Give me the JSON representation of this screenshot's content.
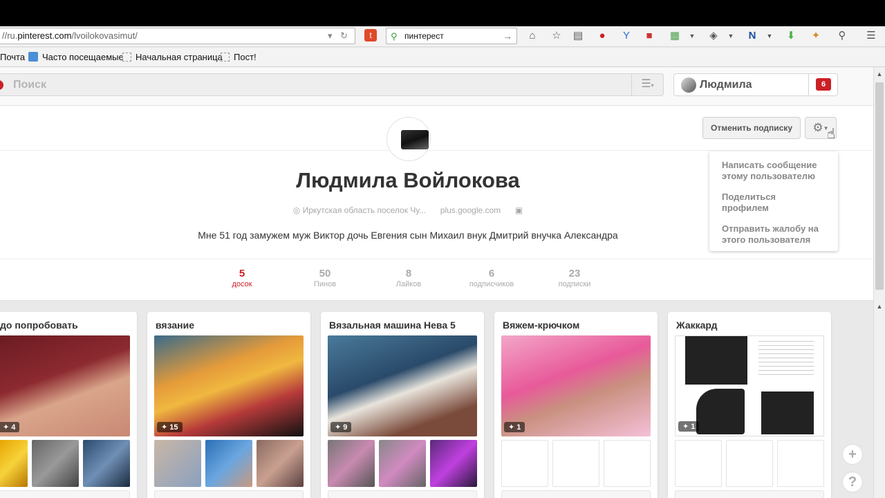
{
  "browser": {
    "url_prefix": "//ru.",
    "url_host": "pinterest.com",
    "url_path": "/lvoilokovasimut/",
    "search_value": "пинтерест"
  },
  "bookmarks": [
    "Почта",
    "Часто посещаемые",
    "Начальная страница",
    "Пост!"
  ],
  "header": {
    "search_placeholder": "Поиск",
    "user_name": "Людмила",
    "notifications": "6"
  },
  "profile": {
    "name": "Людмила Войлокова",
    "location": "Иркутская область поселок Чу...",
    "website": "plus.google.com",
    "bio": "Мне 51 год замужем муж Виктор дочь Евгения сын Михаил внук Дмитрий внучка Александра",
    "unfollow_label": "Отменить подписку",
    "menu": [
      "Написать сообщение этому пользователю",
      "Поделиться профилем",
      "Отправить жалобу на этого пользователя"
    ],
    "stats": [
      {
        "num": "5",
        "label": "досок",
        "active": true
      },
      {
        "num": "50",
        "label": "Пинов",
        "active": false
      },
      {
        "num": "8",
        "label": "Лайков",
        "active": false
      },
      {
        "num": "6",
        "label": "подписчиков",
        "active": false
      },
      {
        "num": "23",
        "label": "подписки",
        "active": false
      }
    ]
  },
  "boards": [
    {
      "title": "до попробовать",
      "count": "4"
    },
    {
      "title": "вязание",
      "count": "15"
    },
    {
      "title": "Вязальная машина Нева 5",
      "count": "9"
    },
    {
      "title": "Вяжем-крючком",
      "count": "1"
    },
    {
      "title": "Жаккард",
      "count": "1"
    }
  ],
  "colors": {
    "brand": "#cb2027"
  },
  "icons": [
    "add-icon",
    "help-icon",
    "gear-icon",
    "pin-icon"
  ]
}
